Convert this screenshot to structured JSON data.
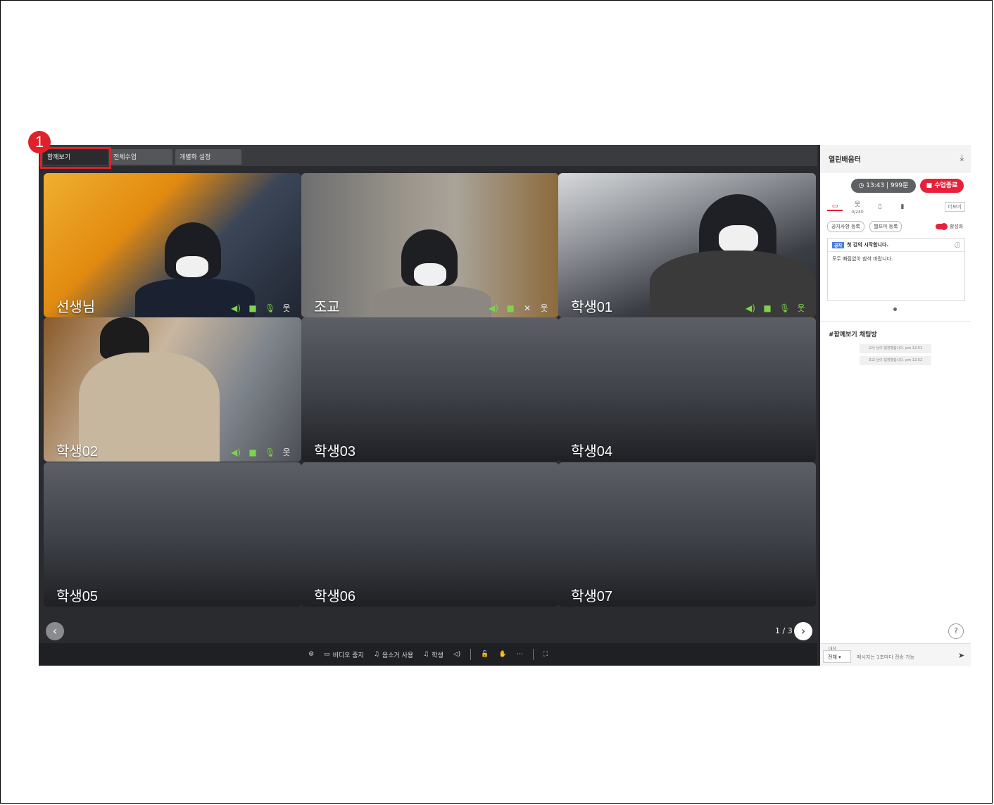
{
  "tabs": [
    "함께보기",
    "전체수업",
    "개별화 설정"
  ],
  "step_badge": "1",
  "tiles": [
    {
      "name": "선생님",
      "video": true,
      "mic": "on"
    },
    {
      "name": "조교",
      "video": true,
      "mic": "muted"
    },
    {
      "name": "학생01",
      "video": true,
      "mic": "on"
    },
    {
      "name": "학생02",
      "video": true,
      "mic": "on"
    },
    {
      "name": "학생03",
      "video": false
    },
    {
      "name": "학생04",
      "video": false
    },
    {
      "name": "학생05",
      "video": false
    },
    {
      "name": "학생06",
      "video": false
    },
    {
      "name": "학생07",
      "video": false
    }
  ],
  "pager": {
    "text": "1 / 3"
  },
  "toolbar": {
    "settings_icon": "gear-icon",
    "video_stop": "비디오 중지",
    "mic_use": "음소거 사용",
    "student_label": "학생"
  },
  "sidebar": {
    "title": "열린배움터",
    "timer": "13:43",
    "timer_sub": "999분",
    "end_class": "수업종료",
    "participants": "0/240",
    "more": "더보기",
    "notice_register": "공지사항 등록",
    "help_register": "헬프미 등록",
    "activate": "활성화",
    "notice_tag": "공지",
    "notice_title": "첫 강의 시작합니다.",
    "notice_body": "모두 빠짐없이 참석 바랍니다.",
    "chat_title": "#함께보기 채팅방",
    "system_messages": [
      "교사 님이 입장했습니다. pm 12:51",
      "조교 님이 입장했습니다. pm 12:52"
    ],
    "target_label": "대상",
    "target_value": "전체",
    "message_placeholder": "메시지는 1초마다 전송 가능"
  },
  "colors": {
    "accent": "#e8213a",
    "active_icon": "#7fd34d",
    "background": "#2a2b2f"
  }
}
